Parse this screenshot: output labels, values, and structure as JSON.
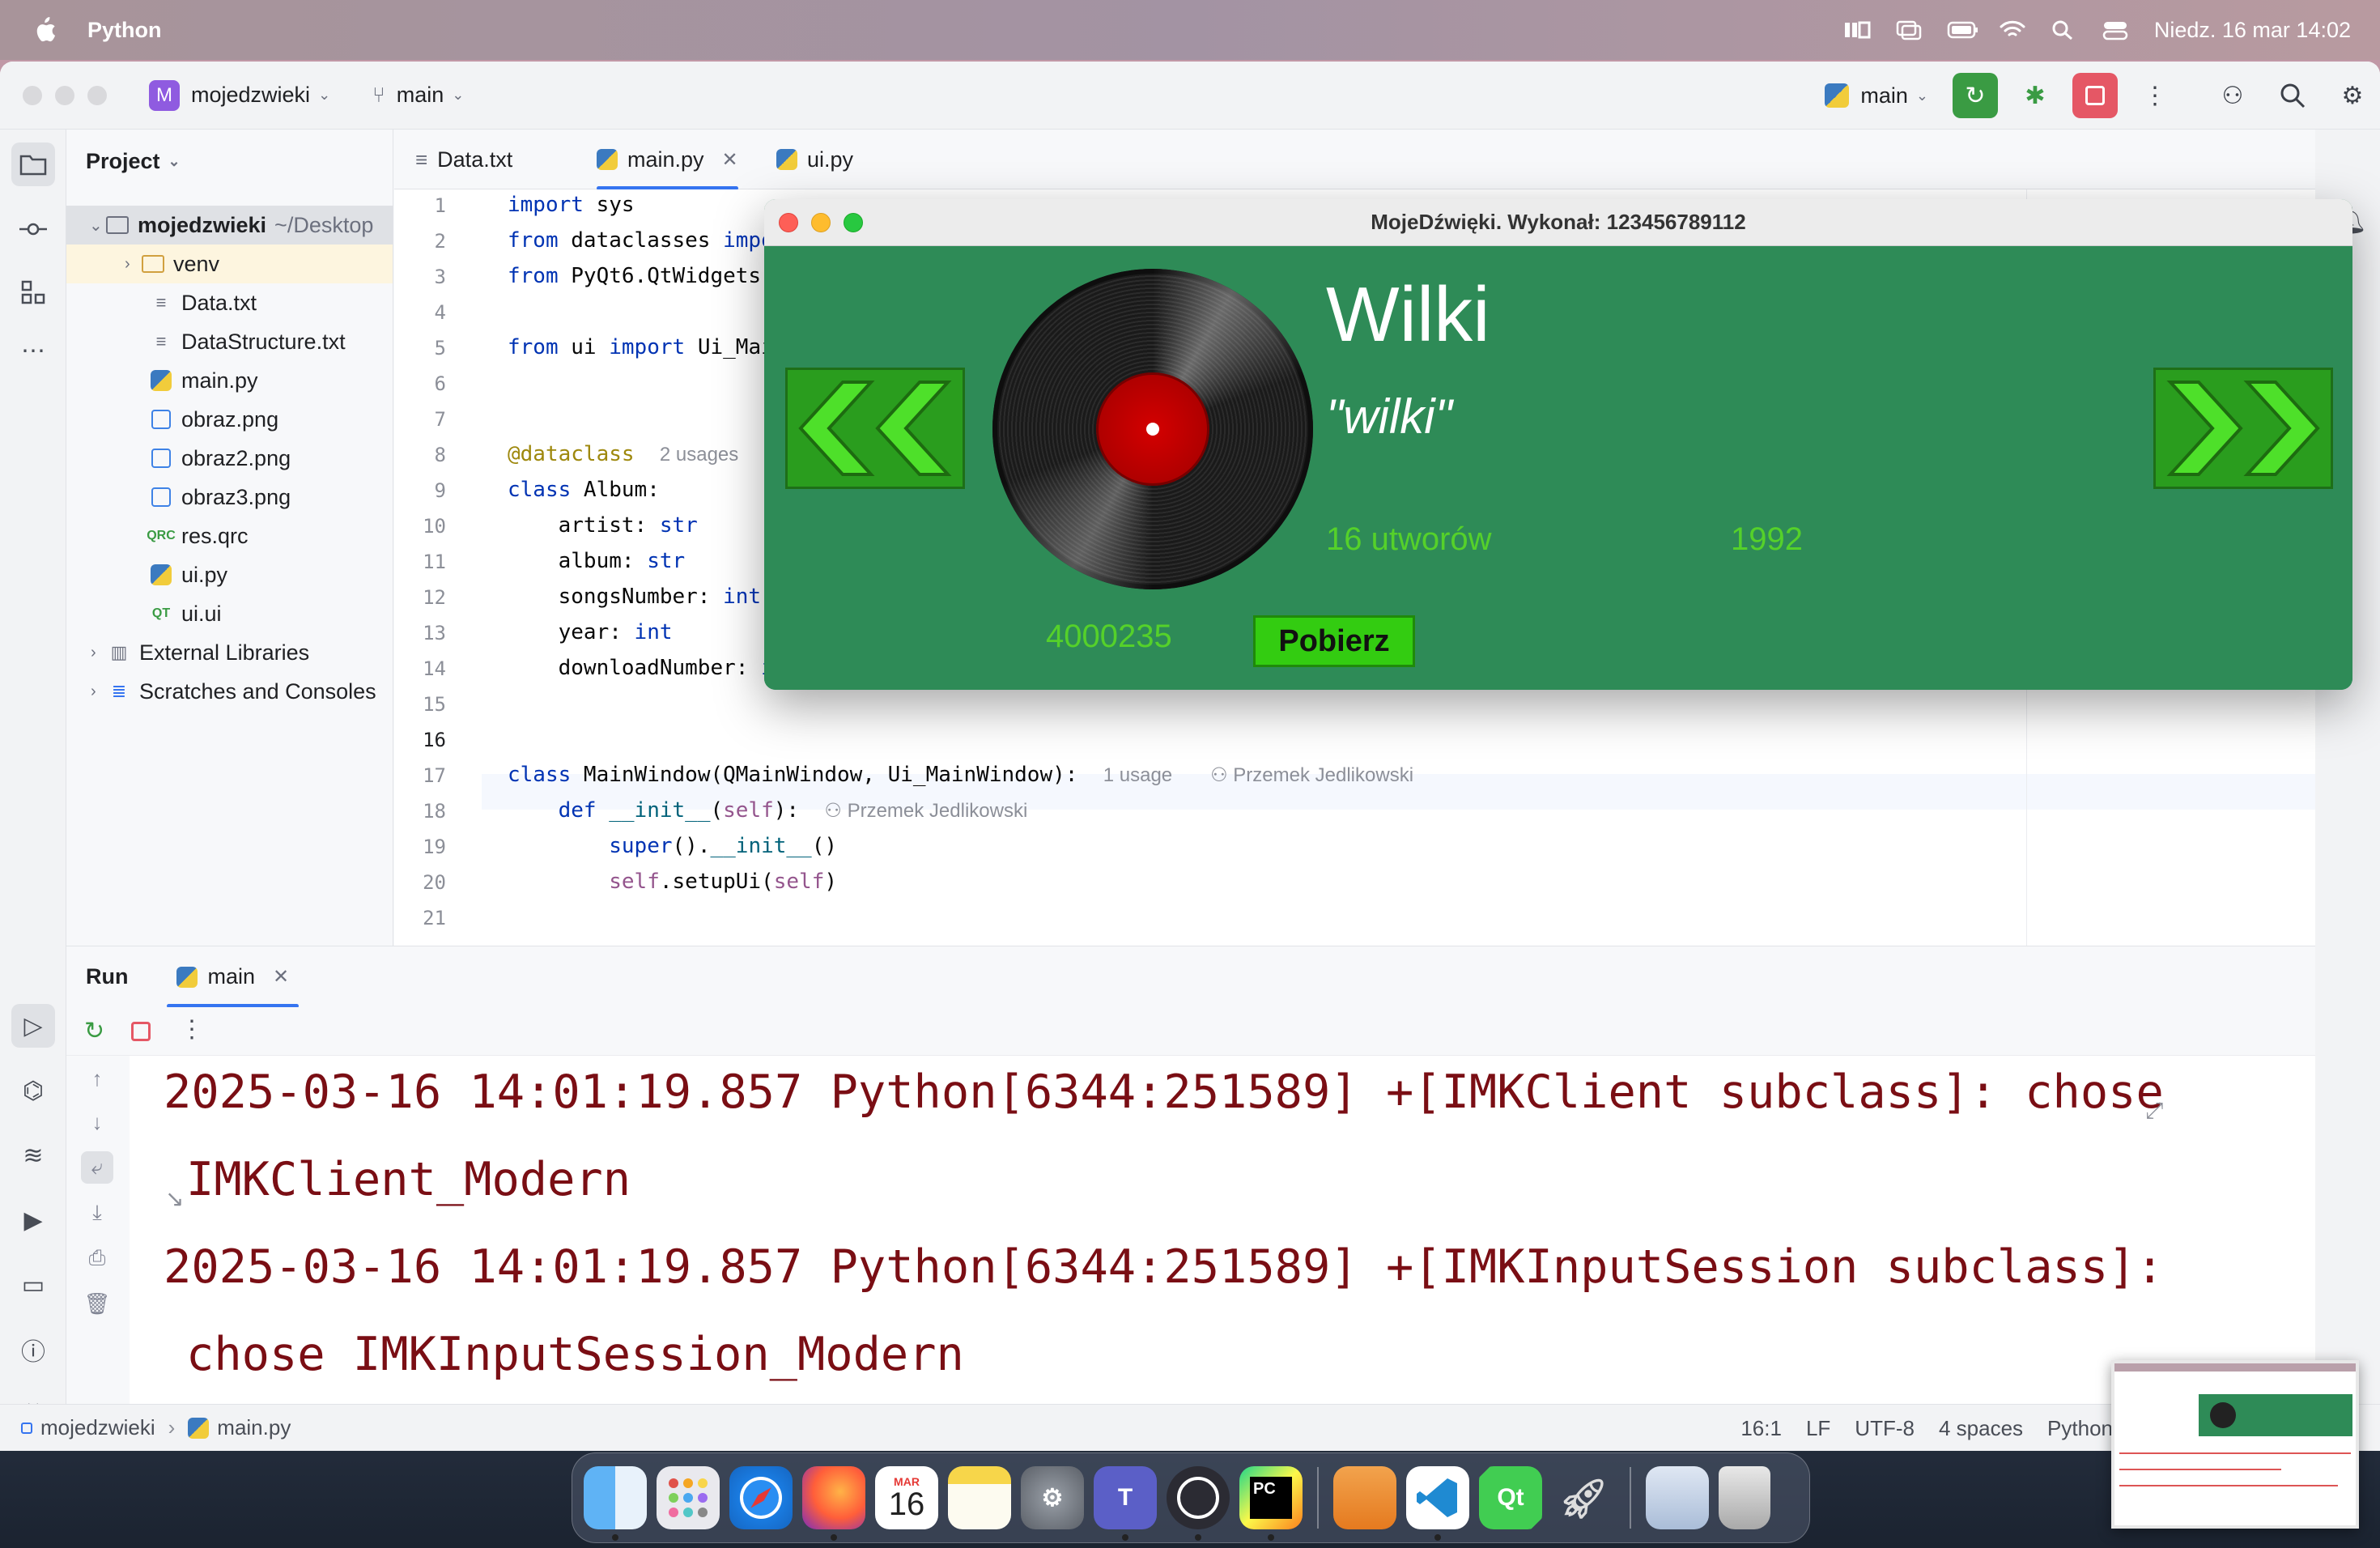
{
  "menubar": {
    "app_name": "Python",
    "datetime": "Niedz. 16 mar  14:02"
  },
  "titlebar": {
    "project_badge": "M",
    "project_name": "mojedzwieki",
    "branch": "main",
    "run_config": "main"
  },
  "project_panel": {
    "title": "Project",
    "root_name": "mojedzwieki",
    "root_path": "~/Desktop",
    "items": [
      {
        "label": "venv",
        "type": "folder"
      },
      {
        "label": "Data.txt",
        "type": "text"
      },
      {
        "label": "DataStructure.txt",
        "type": "text"
      },
      {
        "label": "main.py",
        "type": "python"
      },
      {
        "label": "obraz.png",
        "type": "image"
      },
      {
        "label": "obraz2.png",
        "type": "image"
      },
      {
        "label": "obraz3.png",
        "type": "image"
      },
      {
        "label": "res.qrc",
        "type": "qrc"
      },
      {
        "label": "ui.py",
        "type": "python"
      },
      {
        "label": "ui.ui",
        "type": "qt"
      }
    ],
    "external_libraries": "External Libraries",
    "scratches": "Scratches and Consoles"
  },
  "tabs": [
    {
      "label": "Data.txt"
    },
    {
      "label": "main.py"
    },
    {
      "label": "ui.py"
    }
  ],
  "editor": {
    "lines": [
      "1",
      "2",
      "3",
      "4",
      "5",
      "6",
      "7",
      "8",
      "9",
      "10",
      "11",
      "12",
      "13",
      "14",
      "15",
      "16",
      "17",
      "18",
      "19",
      "20",
      "21"
    ],
    "usages_8": "2 usages",
    "usage_17": "1 usage",
    "author": "Przemek Jedlikowski"
  },
  "run": {
    "tab_title": "Run",
    "config": "main",
    "output": [
      "2025-03-16 14:01:19.857 Python[6344:251589] +[IMKClient subclass]: chose",
      "IMKClient_Modern",
      "2025-03-16 14:01:19.857 Python[6344:251589] +[IMKInputSession subclass]:",
      "chose IMKInputSession_Modern"
    ]
  },
  "statusbar": {
    "project": "mojedzwieki",
    "file": "main.py",
    "position": "16:1",
    "line_sep": "LF",
    "encoding": "UTF-8",
    "indent": "4 spaces",
    "interpreter": "Python"
  },
  "qt_app": {
    "title": "MojeDźwięki. Wykonał: 123456789112",
    "artist": "Wilki",
    "album": "\"wilki\"",
    "songs": "16 utworów",
    "year": "1992",
    "downloads": "4000235",
    "download_button": "Pobierz",
    "bg_color": "#2e8b57",
    "accent_color": "#55d12a"
  },
  "dock": {
    "calendar_month": "MAR",
    "calendar_day": "16",
    "apps": [
      "finder-icon",
      "launchpad-icon",
      "safari-icon",
      "firefox-icon",
      "calendar-icon",
      "notes-icon",
      "system-settings-icon",
      "teams-icon",
      "obs-icon",
      "pycharm-icon",
      "preview-icon",
      "vscode-icon",
      "qt-creator-icon",
      "rocket-icon",
      "files-icon",
      "trash-icon"
    ]
  }
}
